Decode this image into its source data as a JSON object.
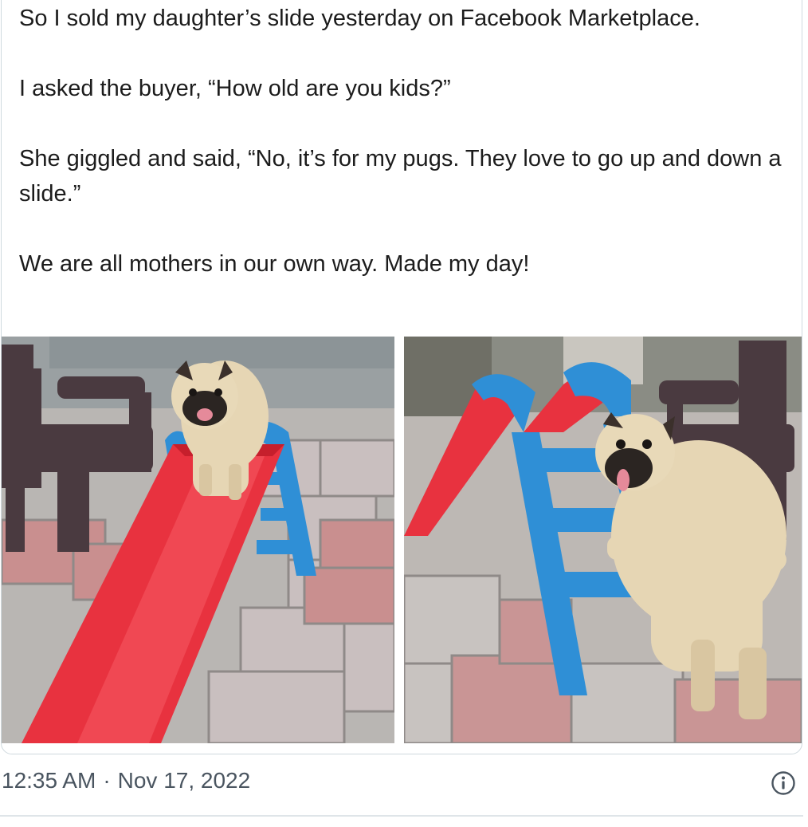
{
  "post": {
    "paragraphs": [
      "So I sold my daughter’s slide yesterday on Facebook Marketplace.",
      "I asked the buyer, “How old are you kids?”",
      "She giggled and said, “No, it’s for my pugs. They love to go up and down a slide.”",
      "We are all mothers in our own way. Made my day!"
    ],
    "images": [
      {
        "name": "pug-on-top-of-red-slide-photo"
      },
      {
        "name": "pug-beside-blue-slide-ladder-photo"
      }
    ]
  },
  "footer": {
    "time": "12:35 AM",
    "separator": "·",
    "date": "Nov 17, 2022",
    "info_icon": "info-circle-icon"
  },
  "colors": {
    "slide_red": "#e8323f",
    "slide_blue": "#2f8fd6",
    "chair": "#4a3a40",
    "pug_fawn": "#e6d6b4",
    "text": "#1c1c1c",
    "meta_text": "#4a5560",
    "card_border": "#cfd9de"
  }
}
